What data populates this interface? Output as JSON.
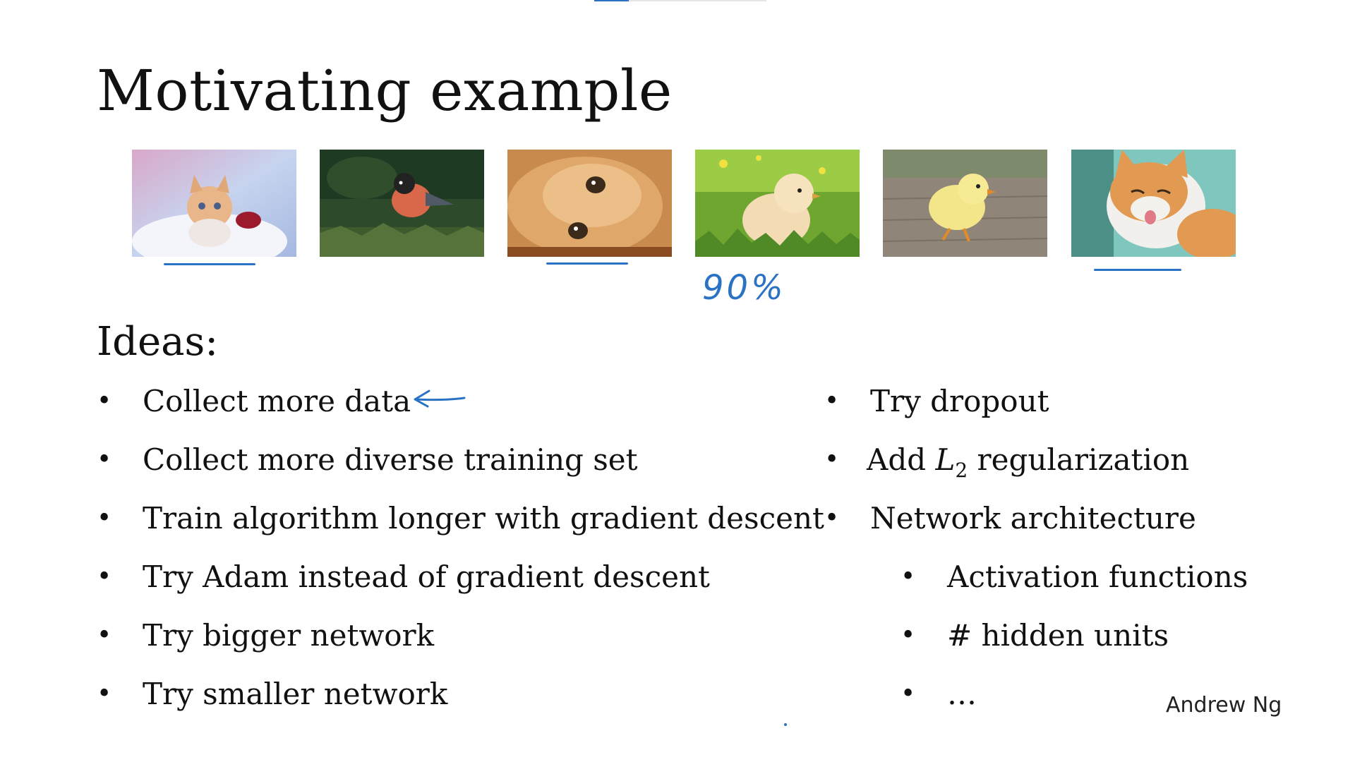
{
  "slide": {
    "title": "Motivating example",
    "ideas_heading": "Ideas:",
    "author": "Andrew Ng",
    "progress_fraction": 0.2
  },
  "images": [
    {
      "subject": "kitten",
      "underlined": true
    },
    {
      "subject": "bird",
      "underlined": false
    },
    {
      "subject": "cat",
      "underlined": true
    },
    {
      "subject": "chick",
      "underlined": false
    },
    {
      "subject": "chick",
      "underlined": false
    },
    {
      "subject": "cat",
      "underlined": true
    }
  ],
  "annotations": {
    "accuracy_note": "90%"
  },
  "ideas_left": [
    "Collect more data",
    "Collect more diverse training set",
    "Train algorithm longer with gradient descent",
    "Try Adam instead of gradient descent",
    "Try bigger network",
    "Try smaller network"
  ],
  "ideas_right": {
    "dropout": "Try dropout",
    "l2_prefix": "Add ",
    "l2_symbol": "L",
    "l2_subscript": "2",
    "l2_suffix": " regularization",
    "architecture": "Network architecture",
    "sub_items": [
      "Activation functions",
      "# hidden units",
      "…"
    ]
  },
  "bullet_glyph": "•",
  "colors": {
    "ink": "#111111",
    "annotation_blue": "#2a72c4",
    "background": "#ffffff"
  }
}
